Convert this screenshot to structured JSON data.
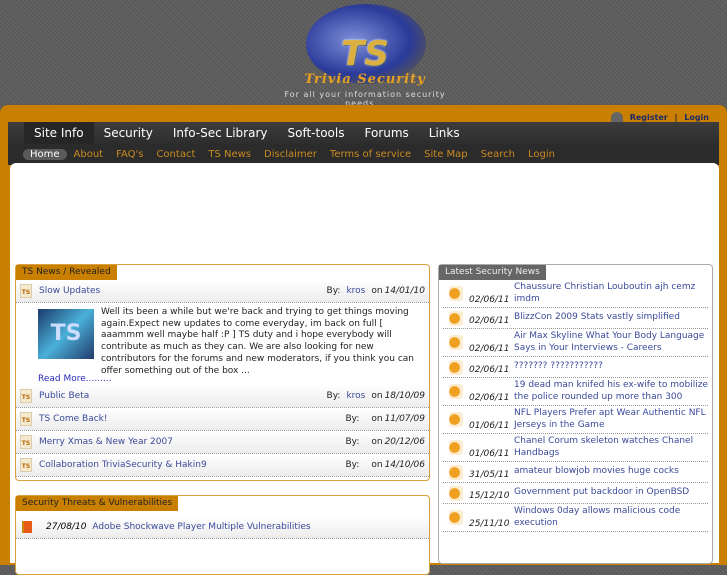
{
  "logo": {
    "initials": "TS",
    "name": "Trivia Security",
    "tagline": "For all your information security needs..."
  },
  "user": {
    "register": "Register",
    "sep": "|",
    "login": "Login",
    "icon": "user-icon"
  },
  "tabs": [
    "Site Info",
    "Security",
    "Info-Sec Library",
    "Soft-tools",
    "Forums",
    "Links"
  ],
  "subnav": [
    "Home",
    "About",
    "FAQ's",
    "Contact",
    "TS News",
    "Disclaimer",
    "Terms of service",
    "Site Map",
    "Search",
    "Login"
  ],
  "ts_news": {
    "title": "TS News / Revealed",
    "by_label": "By:",
    "on_label": "on",
    "featured": {
      "title": "Slow Updates",
      "author": "kros",
      "date": "14/01/10",
      "thumb": "TS",
      "body": "Well its been a while but we're back and trying to get things moving again.Expect new updates to come everyday, im back on full [ aaammm well maybe half :P ] TS duty and i hope everybody will contribute as much as they can. We are also looking for new contributors for the forums and new moderators, if you think you can offer something out of the box ...",
      "read_more": "Read More........."
    },
    "items": [
      {
        "title": "Public Beta",
        "author": "kros",
        "date": "18/10/09"
      },
      {
        "title": "TS Come Back!",
        "author": "",
        "date": "11/07/09"
      },
      {
        "title": "Merry Xmas & New Year 2007",
        "author": "",
        "date": "20/12/06"
      },
      {
        "title": "Collaboration TriviaSecurity & Hakin9",
        "author": "",
        "date": "14/10/06"
      }
    ]
  },
  "threats": {
    "title": "Security Threats & Vulnerabilities",
    "items": [
      {
        "date": "27/08/10",
        "title": "Adobe Shockwave Player Multiple Vulnerabilities"
      }
    ]
  },
  "latest": {
    "title": "Latest Security News",
    "items": [
      {
        "date": "02/06/11",
        "title": "Chaussure Christian Louboutin ajh cemz imdm"
      },
      {
        "date": "02/06/11",
        "title": "BlizzCon 2009 Stats vastly simplified"
      },
      {
        "date": "02/06/11",
        "title": "Air Max Skyline What Your Body Language Says in Your Interviews - Careers"
      },
      {
        "date": "02/06/11",
        "title": "??????? ???????????"
      },
      {
        "date": "02/06/11",
        "title": "19 dead man knifed his ex-wife to mobilize the police rounded up more than 300"
      },
      {
        "date": "01/06/11",
        "title": "NFL Players Prefer apt Wear Authentic NFL Jerseys in the Game"
      },
      {
        "date": "01/06/11",
        "title": "Chanel Corum skeleton watches Chanel Handbags"
      },
      {
        "date": "31/05/11",
        "title": "amateur blowjob movies huge cocks"
      },
      {
        "date": "15/12/10",
        "title": "Government put backdoor in OpenBSD"
      },
      {
        "date": "25/11/10",
        "title": "Windows 0day allows malicious code execution"
      }
    ]
  }
}
